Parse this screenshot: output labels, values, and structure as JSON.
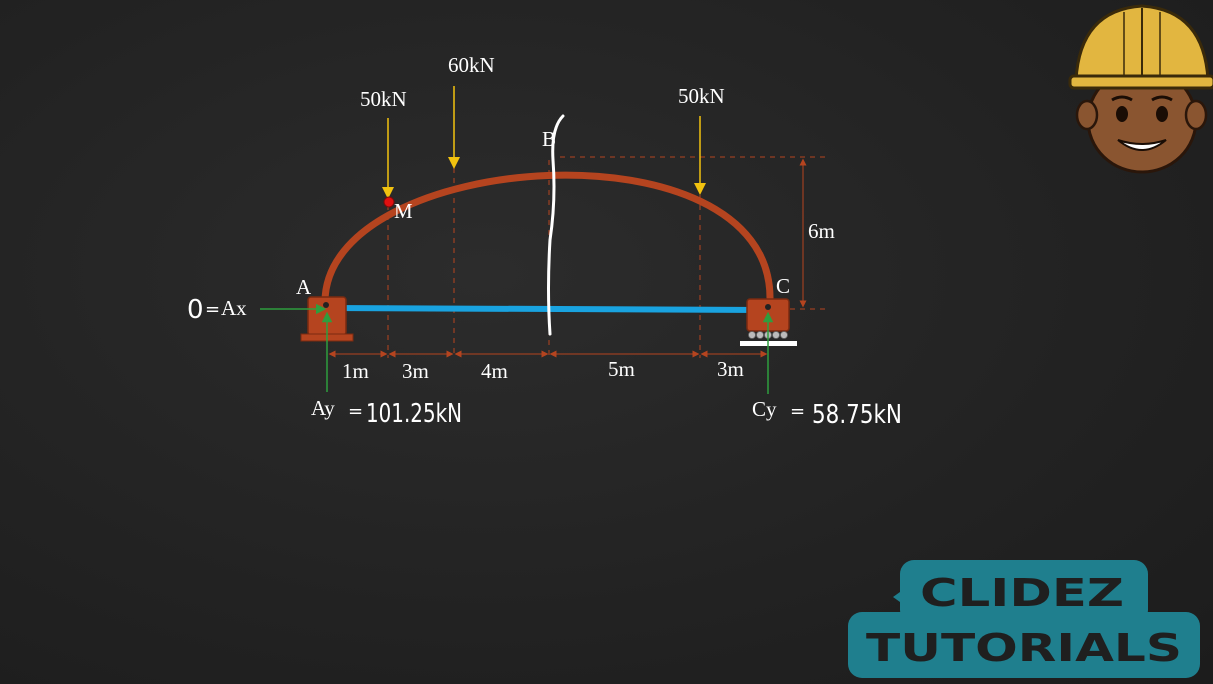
{
  "diagram": {
    "loads": [
      {
        "magnitude": "60kN"
      },
      {
        "magnitude": "50kN"
      },
      {
        "magnitude": "50kN"
      }
    ],
    "points": {
      "a": "A",
      "b": "B",
      "c": "C",
      "m": "M"
    },
    "rise": "6m",
    "spans": [
      "1m",
      "3m",
      "4m",
      "5m",
      "3m"
    ],
    "reactions": {
      "ax_value": "0",
      "ax_eq": "=",
      "ax_label": "Ax",
      "ay_label": "Ay",
      "ay_eq": "=",
      "ay_value": "101.25kN",
      "cy_label": "Cy",
      "cy_eq": "=",
      "cy_value": "58.75kN"
    },
    "colors": {
      "arch": "#b5441f",
      "tie": "#19a3e0",
      "load_arrow": "#f2c20f",
      "reaction_arrow": "#2e9e3e",
      "dimension": "#b5441f",
      "point_m": "#e01010"
    }
  },
  "branding": {
    "line1": "CLIDEZ",
    "line2": "TUTORIALS",
    "logo_color": "#1f7f8e",
    "mascot_icon": "construction-worker-mascot-icon"
  }
}
